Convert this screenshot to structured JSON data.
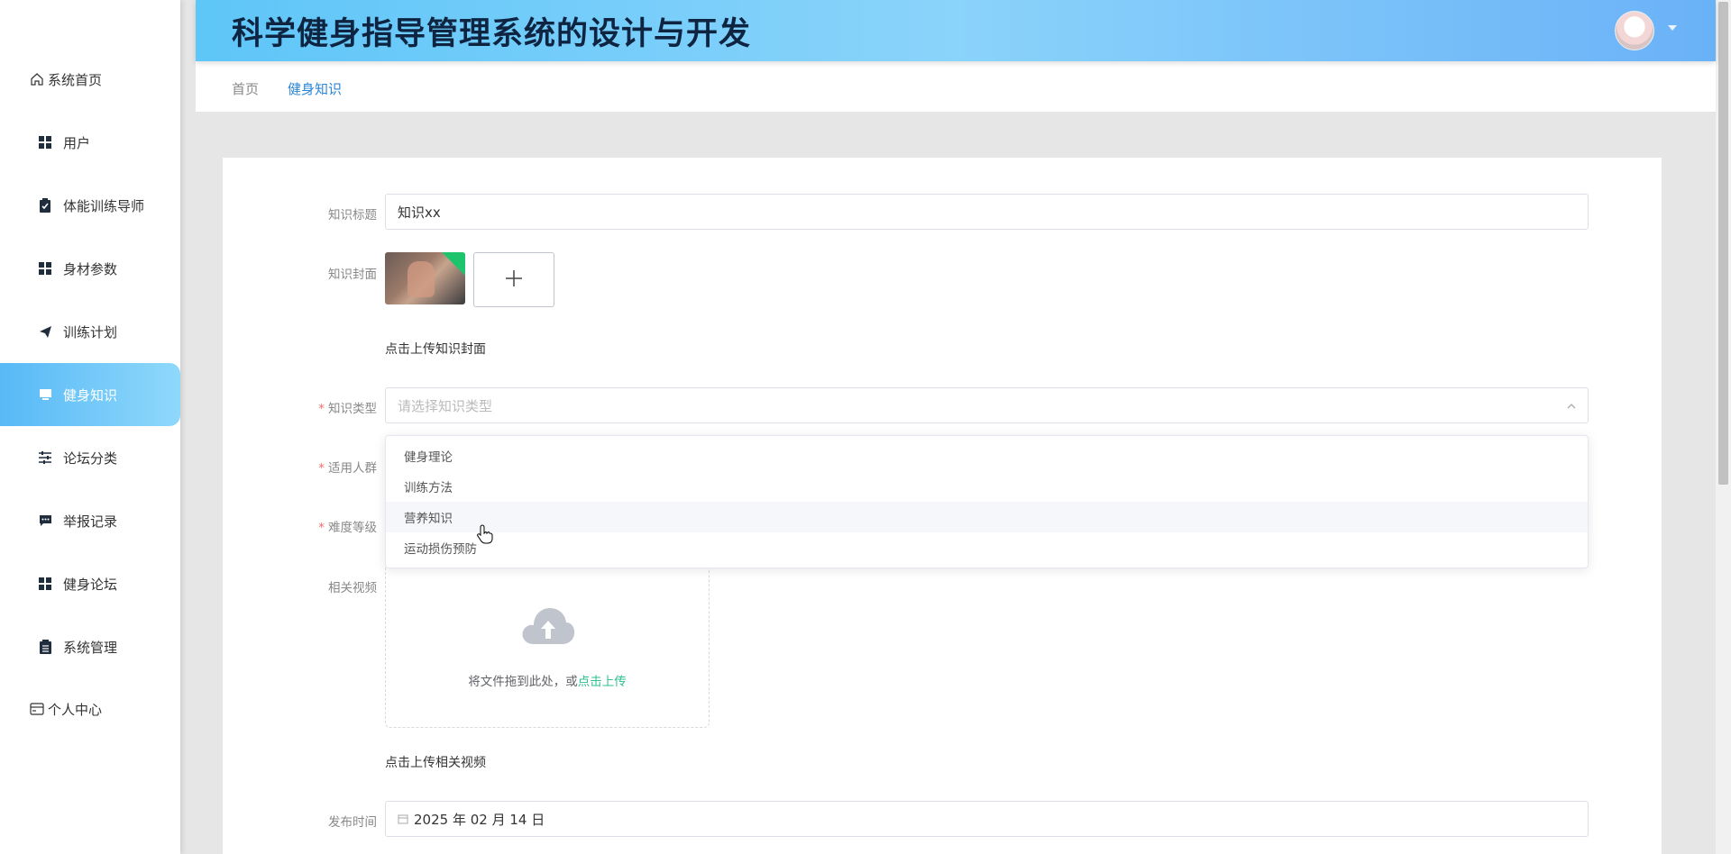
{
  "app": {
    "title": "科学健身指导管理系统的设计与开发"
  },
  "sidebar": {
    "items": [
      {
        "label": "系统首页",
        "icon": "home-icon"
      },
      {
        "label": "用户",
        "icon": "grid-icon"
      },
      {
        "label": "体能训练导师",
        "icon": "clipboard-check-icon"
      },
      {
        "label": "身材参数",
        "icon": "grid-icon"
      },
      {
        "label": "训练计划",
        "icon": "paper-plane-icon"
      },
      {
        "label": "健身知识",
        "icon": "monitor-icon",
        "active": true
      },
      {
        "label": "论坛分类",
        "icon": "sliders-icon"
      },
      {
        "label": "举报记录",
        "icon": "chat-icon"
      },
      {
        "label": "健身论坛",
        "icon": "grid-icon"
      },
      {
        "label": "系统管理",
        "icon": "clipboard-icon"
      },
      {
        "label": "个人中心",
        "icon": "card-icon"
      }
    ]
  },
  "breadcrumb": {
    "home": "首页",
    "current": "健身知识"
  },
  "form": {
    "title_label": "知识标题",
    "title_value": "知识xx",
    "cover_label": "知识封面",
    "cover_hint": "点击上传知识封面",
    "type_label": "知识类型",
    "type_placeholder": "请选择知识类型",
    "crowd_label": "适用人群",
    "difficulty_label": "难度等级",
    "video_label": "相关视频",
    "upload_text": "将文件拖到此处，或",
    "upload_link": "点击上传",
    "video_hint": "点击上传相关视频",
    "date_label": "发布时间",
    "date_value": "2025 年 02 月 14 日"
  },
  "dropdown": {
    "options": [
      "健身理论",
      "训练方法",
      "营养知识",
      "运动损伤预防"
    ],
    "hovered_index": 2
  },
  "colors": {
    "accent": "#2a86d6",
    "active_gradient_start": "#57b9f6",
    "required": "#f56c6c",
    "upload_link": "#2ec08f"
  }
}
